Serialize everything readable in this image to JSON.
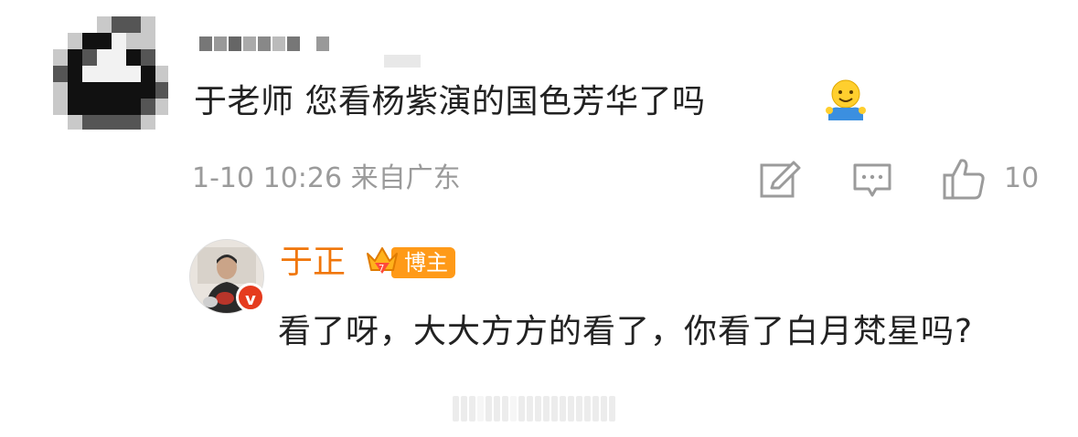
{
  "comment": {
    "text": "于老师 您看杨紫演的国色芳华了吗",
    "emoji": "hugging-face-emoji",
    "time": "1-10 10:26",
    "location": "来自广东",
    "like_count": "10"
  },
  "reply": {
    "name": "于正",
    "badge_label": "博主",
    "verified_mark": "v",
    "text": "看了呀，大大方方的看了，你看了白月梵星吗?"
  },
  "colors": {
    "name_orange": "#f0760a",
    "tag_orange": "#ff9a18",
    "meta_gray": "#9b9b9b",
    "verify_red": "#e53b1e"
  }
}
